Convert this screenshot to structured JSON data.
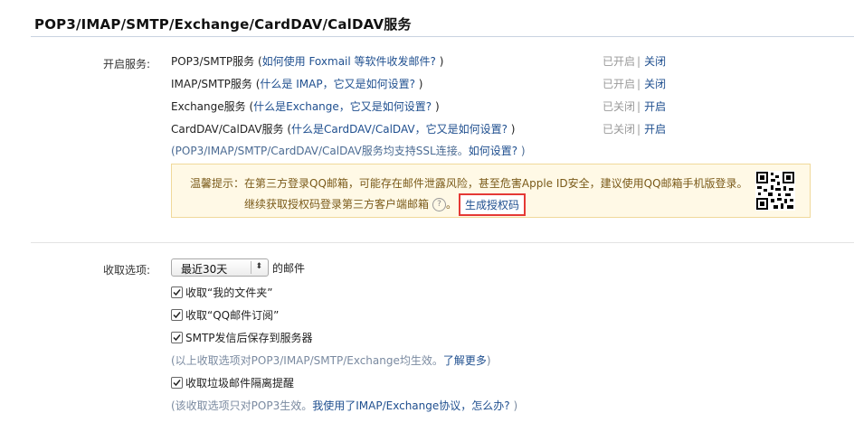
{
  "section": {
    "title": "POP3/IMAP/SMTP/Exchange/CardDAV/CalDAV服务"
  },
  "services": {
    "label": "开启服务:",
    "items": [
      {
        "name": "POP3/SMTP服务",
        "open": " (",
        "link": "如何使用 Foxmail 等软件收发邮件?",
        "close": " )",
        "state": "已开启",
        "action": "关闭"
      },
      {
        "name": "IMAP/SMTP服务",
        "open": " (",
        "link": "什么是 IMAP，它又是如何设置?",
        "close": " )",
        "state": "已开启",
        "action": "关闭"
      },
      {
        "name": "Exchange服务",
        "open": " (",
        "link": "什么是Exchange，它又是如何设置?",
        "close": " )",
        "state": "已关闭",
        "action": "开启"
      },
      {
        "name": "CardDAV/CalDAV服务",
        "open": " (",
        "link": "什么是CardDAV/CalDAV，它又是如何设置?",
        "close": " )",
        "state": "已关闭",
        "action": "开启"
      }
    ],
    "separator": "|",
    "ssl_note_prefix": "(POP3/IMAP/SMTP/CardDAV/CalDAV服务均支持SSL连接。",
    "ssl_note_link": "如何设置?",
    "ssl_note_suffix": " )"
  },
  "notice": {
    "line1": "温馨提示：在第三方登录QQ邮箱，可能存在邮件泄露风险，甚至危害Apple ID安全，建议使用QQ邮箱手机版登录。",
    "line2": "继续获取授权码登录第三方客户端邮箱",
    "help_icon": "?",
    "after_help": "。",
    "button": "生成授权码"
  },
  "receive": {
    "label": "收取选项:",
    "select_value": "最近30天",
    "select_suffix": "的邮件",
    "options": [
      {
        "label": "收取“我的文件夹”",
        "checked": true
      },
      {
        "label": "收取“QQ邮件订阅”",
        "checked": true
      },
      {
        "label": "SMTP发信后保存到服务器",
        "checked": true
      }
    ],
    "note1_prefix": "(以上收取选项对POP3/IMAP/SMTP/Exchange均生效。",
    "note1_link": "了解更多",
    "note1_suffix": ")",
    "spam_option": {
      "label": "收取垃圾邮件隔离提醒",
      "checked": true
    },
    "note2_prefix": "(该收取选项只对POP3生效。",
    "note2_link": "我使用了IMAP/Exchange协议，怎么办?",
    "note2_suffix": " )"
  }
}
